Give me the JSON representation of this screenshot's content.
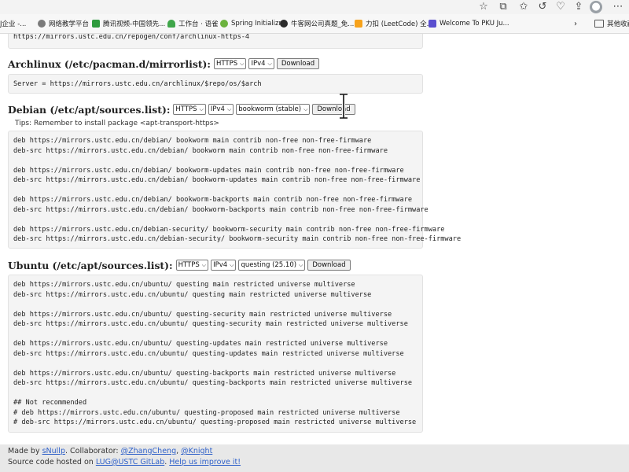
{
  "bookmarks": [
    {
      "label": "J企业 -...",
      "icon": "none"
    },
    {
      "label": "网络教学平台",
      "icon": "globe-icon"
    },
    {
      "label": "腾讯视频-中国领先...",
      "icon": "tencent-video-icon"
    },
    {
      "label": "工作台 · 语雀",
      "icon": "yuque-icon"
    },
    {
      "label": "Spring Initializr",
      "icon": "spring-icon"
    },
    {
      "label": "牛客网公司真题_免...",
      "icon": "niuke-icon"
    },
    {
      "label": "力扣 (LeetCode) 全...",
      "icon": "leetcode-icon"
    },
    {
      "label": "Welcome To PKU Ju...",
      "icon": "pku-icon"
    },
    {
      "label": "其他收藏",
      "icon": "folder-icon"
    }
  ],
  "top_pre": {
    "lines": [
      "https://mirrors.ustc.edu.cn/repogen/conf/archlinux-https-4"
    ]
  },
  "arch": {
    "title": "Archlinux (/etc/pacman.d/mirrorlist):",
    "protocol": "HTTPS",
    "ip": "IPv4",
    "button": "Download",
    "lines": [
      "Server = https://mirrors.ustc.edu.cn/archlinux/$repo/os/$arch"
    ]
  },
  "debian": {
    "title": "Debian (/etc/apt/sources.list):",
    "protocol": "HTTPS",
    "ip": "IPv4",
    "release": "bookworm (stable)",
    "button": "Download",
    "tips": "Tips: Remember to install package <apt-transport-https>",
    "lines": [
      "deb https://mirrors.ustc.edu.cn/debian/ bookworm main contrib non-free non-free-firmware",
      "deb-src https://mirrors.ustc.edu.cn/debian/ bookworm main contrib non-free non-free-firmware",
      "",
      "deb https://mirrors.ustc.edu.cn/debian/ bookworm-updates main contrib non-free non-free-firmware",
      "deb-src https://mirrors.ustc.edu.cn/debian/ bookworm-updates main contrib non-free non-free-firmware",
      "",
      "deb https://mirrors.ustc.edu.cn/debian/ bookworm-backports main contrib non-free non-free-firmware",
      "deb-src https://mirrors.ustc.edu.cn/debian/ bookworm-backports main contrib non-free non-free-firmware",
      "",
      "deb https://mirrors.ustc.edu.cn/debian-security/ bookworm-security main contrib non-free non-free-firmware",
      "deb-src https://mirrors.ustc.edu.cn/debian-security/ bookworm-security main contrib non-free non-free-firmware"
    ]
  },
  "ubuntu": {
    "title": "Ubuntu (/etc/apt/sources.list):",
    "protocol": "HTTPS",
    "ip": "IPv4",
    "release": "questing (25.10)",
    "button": "Download",
    "lines": [
      "deb https://mirrors.ustc.edu.cn/ubuntu/ questing main restricted universe multiverse",
      "deb-src https://mirrors.ustc.edu.cn/ubuntu/ questing main restricted universe multiverse",
      "",
      "deb https://mirrors.ustc.edu.cn/ubuntu/ questing-security main restricted universe multiverse",
      "deb-src https://mirrors.ustc.edu.cn/ubuntu/ questing-security main restricted universe multiverse",
      "",
      "deb https://mirrors.ustc.edu.cn/ubuntu/ questing-updates main restricted universe multiverse",
      "deb-src https://mirrors.ustc.edu.cn/ubuntu/ questing-updates main restricted universe multiverse",
      "",
      "deb https://mirrors.ustc.edu.cn/ubuntu/ questing-backports main restricted universe multiverse",
      "deb-src https://mirrors.ustc.edu.cn/ubuntu/ questing-backports main restricted universe multiverse",
      "",
      "## Not recommended",
      "# deb https://mirrors.ustc.edu.cn/ubuntu/ questing-proposed main restricted universe multiverse",
      "# deb-src https://mirrors.ustc.edu.cn/ubuntu/ questing-proposed main restricted universe multiverse"
    ]
  },
  "footer": {
    "made_by": "Made by ",
    "author": "sNullp",
    "collab": ". Collaborator: ",
    "collab1": "@ZhangCheng",
    "sep": ", ",
    "collab2": "@Knight",
    "source_prefix": "Source code hosted on ",
    "source_link": "LUG@USTC GitLab",
    "source_sep": ". ",
    "help_link": "Help us improve it!"
  }
}
